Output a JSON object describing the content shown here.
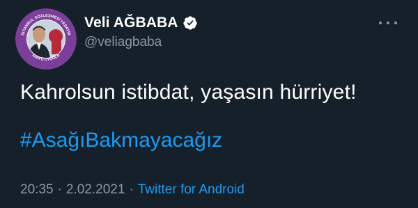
{
  "user": {
    "display_name": "Veli AĞBABA",
    "handle": "@veliagbaba",
    "verified": true,
    "avatar_ring_text_top": "İSTANBUL SÖZLEŞMESİ YAŞATIR",
    "avatar_ring_text_bottom": "6284'Ü UYGULA"
  },
  "tweet": {
    "text": "Kahrolsun istibdat, yaşasın hürriyet!",
    "hashtag": "#AsağıBakmayacağız"
  },
  "meta": {
    "time": "20:35",
    "separator": "·",
    "date": "2.02.2021",
    "source": "Twitter for Android"
  },
  "colors": {
    "background": "#15202b",
    "text_primary": "#ffffff",
    "text_secondary": "#8b98a5",
    "accent": "#1d9bf0",
    "avatar_ring": "#7b3f99"
  },
  "icons": {
    "verified": "verified-badge-icon",
    "more": "more-options-icon"
  }
}
